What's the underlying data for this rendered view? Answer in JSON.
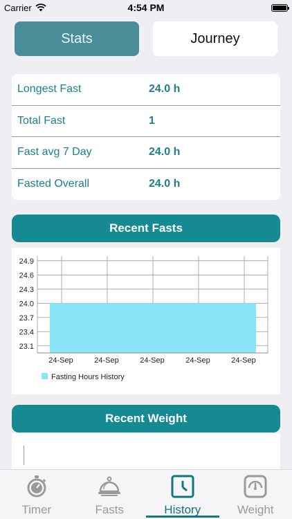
{
  "status_bar": {
    "carrier": "Carrier",
    "time": "4:54 PM"
  },
  "segments": {
    "stats": "Stats",
    "journey": "Journey",
    "active": "stats"
  },
  "stats": [
    {
      "label": "Longest Fast",
      "value": "24.0 h"
    },
    {
      "label": "Total Fast",
      "value": "1"
    },
    {
      "label": "Fast avg 7 Day",
      "value": "24.0 h"
    },
    {
      "label": "Fasted Overall",
      "value": "24.0 h"
    }
  ],
  "recent_fasts": {
    "title": "Recent Fasts"
  },
  "recent_weight": {
    "title": "Recent Weight"
  },
  "chart_data": {
    "type": "area",
    "title": "",
    "xlabel": "",
    "ylabel": "",
    "x_tick_labels": [
      "24-Sep",
      "24-Sep",
      "24-Sep",
      "24-Sep",
      "24-Sep"
    ],
    "y_tick_labels": [
      "24.9",
      "24.6",
      "24.3",
      "24.0",
      "23.7",
      "23.4",
      "23.1"
    ],
    "ylim": [
      22.95,
      25.0
    ],
    "series": [
      {
        "name": "Fasting Hours History",
        "values": [
          24.0,
          24.0,
          24.0,
          24.0,
          24.0
        ],
        "color": "#89e6f7"
      }
    ],
    "grid": true,
    "legend": "bottom-left"
  },
  "tabs": [
    {
      "id": "timer",
      "label": "Timer",
      "icon": "stopwatch-icon"
    },
    {
      "id": "fasts",
      "label": "Fasts",
      "icon": "food-cloche-icon"
    },
    {
      "id": "history",
      "label": "History",
      "icon": "clock-icon"
    },
    {
      "id": "weight",
      "label": "Weight",
      "icon": "scale-icon"
    }
  ],
  "active_tab": "history",
  "colors": {
    "accent": "#158a92",
    "tab_active": "#13747d",
    "segment_active": "#4a8e99",
    "text_teal": "#1b7f8d"
  }
}
